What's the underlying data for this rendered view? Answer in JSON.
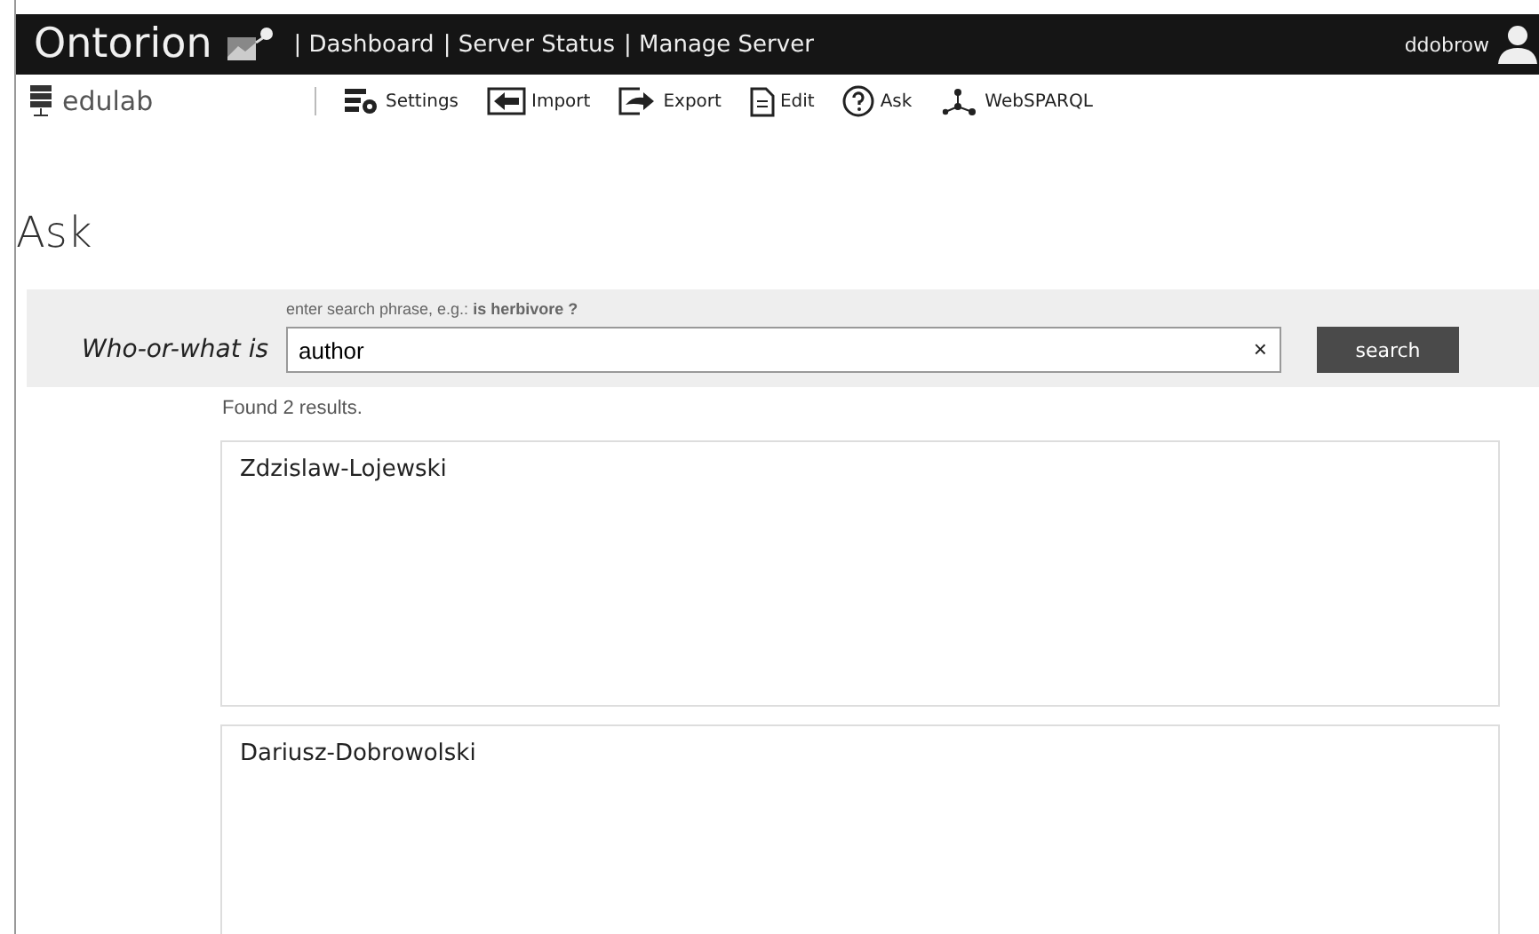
{
  "header": {
    "brand": "Ontorion",
    "nav": [
      {
        "label": "| Dashboard"
      },
      {
        "label": "| Server Status"
      },
      {
        "label": "| Manage Server"
      }
    ],
    "user": "ddobrow"
  },
  "toolbar": {
    "site": "edulab",
    "actions": [
      {
        "kind": "settings",
        "label": "Settings"
      },
      {
        "kind": "import",
        "label": "Import"
      },
      {
        "kind": "export",
        "label": "Export"
      },
      {
        "kind": "edit",
        "label": "Edit"
      },
      {
        "kind": "ask",
        "label": "Ask"
      },
      {
        "kind": "sparql",
        "label": "WebSPARQL"
      }
    ]
  },
  "page_title": "Ask",
  "search": {
    "hint": "enter search phrase, e.g.: **is herbivore ?**",
    "label": "Who-or-what is",
    "value": "author",
    "clear": "×",
    "button": "search"
  },
  "results": {
    "summary": "Found 2 results.",
    "items": [
      {
        "name": "Zdzislaw-Lojewski"
      },
      {
        "name": "Dariusz-Dobrowolski"
      }
    ]
  }
}
